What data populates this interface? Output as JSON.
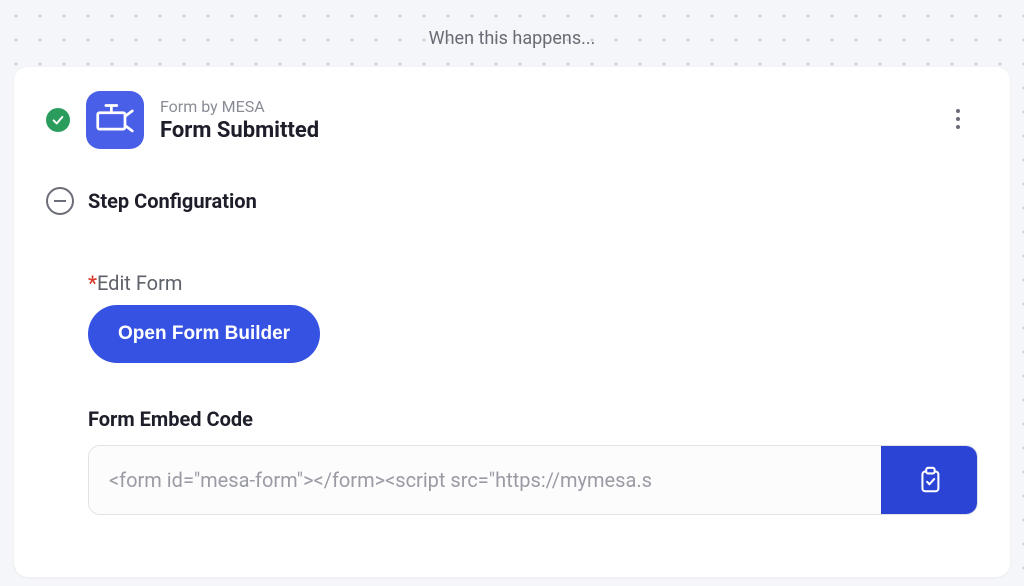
{
  "header": {
    "prompt": "When this happens..."
  },
  "step": {
    "app_name": "Form by MESA",
    "event_name": "Form Submitted"
  },
  "section": {
    "title": "Step Configuration"
  },
  "config": {
    "edit_form": {
      "label": "Edit Form",
      "button": "Open Form Builder"
    },
    "embed": {
      "label": "Form Embed Code",
      "value": "<form id=\"mesa-form\"></form><script src=\"https://mymesa.s"
    }
  }
}
